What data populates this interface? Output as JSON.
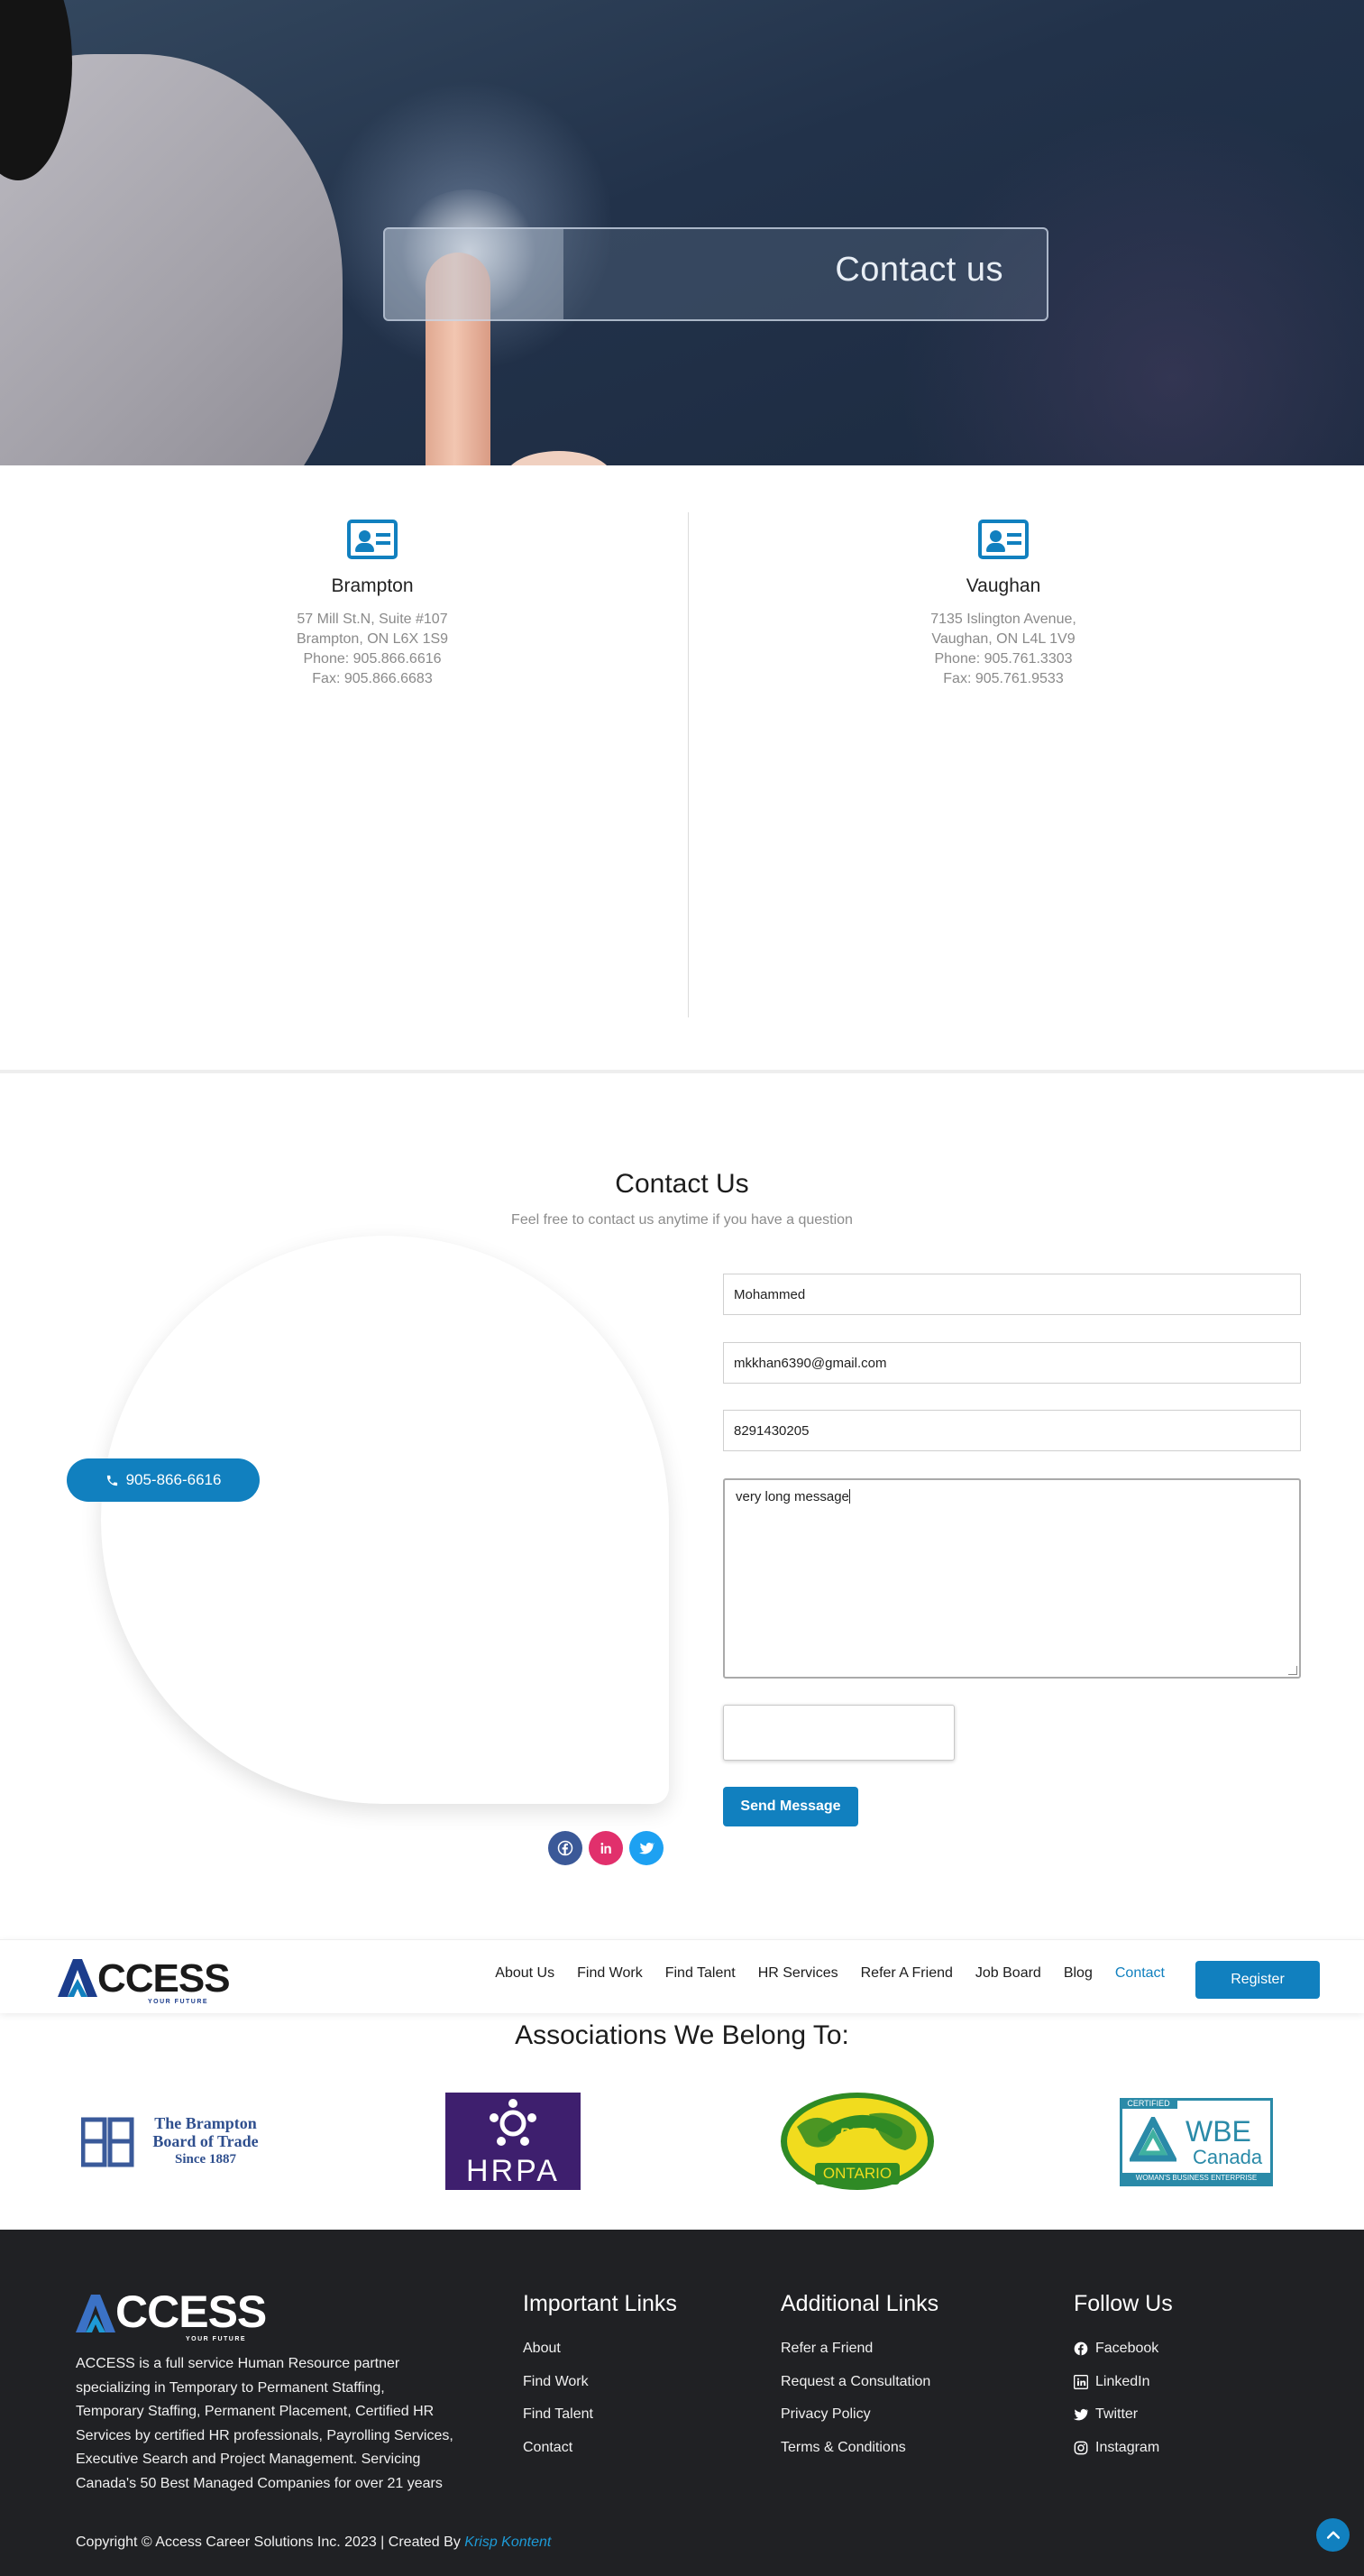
{
  "hero": {
    "title": "Contact us"
  },
  "offices": [
    {
      "name": "Brampton",
      "lines": [
        "57 Mill St.N, Suite #107",
        "Brampton, ON L6X 1S9",
        "Phone: 905.866.6616",
        "Fax: 905.866.6683"
      ]
    },
    {
      "name": "Vaughan",
      "lines": [
        "7135 Islington Avenue,",
        "Vaughan, ON L4L 1V9",
        "Phone: 905.761.3303",
        "Fax: 905.761.9533"
      ]
    }
  ],
  "contact": {
    "title": "Contact Us",
    "subtitle": "Feel free to contact us anytime if you have a question",
    "phone_button": "905-866-6616",
    "form": {
      "name": "Mohammed",
      "email": "mkkhan6390@gmail.com",
      "phone": "8291430205",
      "message": "very long message",
      "send_label": "Send Message"
    },
    "socials": [
      "facebook-icon",
      "linkedin-icon",
      "twitter-icon"
    ]
  },
  "nav": {
    "logo": {
      "word": "CCESS",
      "tagline": "YOUR FUTURE"
    },
    "links": [
      "About Us",
      "Find Work",
      "Find Talent",
      "HR Services",
      "Refer A Friend",
      "Job Board",
      "Blog",
      "Contact"
    ],
    "active": "Contact",
    "register_label": "Register"
  },
  "associations": {
    "title": "Associations We Belong To:",
    "logos": [
      {
        "name": "brampton-board-of-trade",
        "lines": [
          "The Brampton",
          "Board of Trade",
          "Since 1887"
        ]
      },
      {
        "name": "hrpa",
        "text": "HRPA"
      },
      {
        "name": "bpw-ontario",
        "top": "BPW",
        "bottom": "ONTARIO"
      },
      {
        "name": "wbe-canada",
        "certified": "CERTIFIED",
        "word": "WBE",
        "sub": "Canada",
        "bottom": "WOMAN'S BUSINESS ENTERPRISE"
      }
    ]
  },
  "footer": {
    "logo": {
      "word": "CCESS",
      "tagline": "YOUR FUTURE"
    },
    "description": "ACCESS is a full service Human Resource partner specializing in Temporary to Permanent Staffing, Temporary Staffing, Permanent Placement, Certified HR Services by certified HR professionals, Payrolling Services, Executive Search and Project Management. Servicing Canada's 50 Best Managed Companies for over 21 years",
    "important_links": {
      "title": "Important Links",
      "items": [
        "About",
        "Find Work",
        "Find Talent",
        "Contact"
      ]
    },
    "additional_links": {
      "title": "Additional Links",
      "items": [
        "Refer a Friend",
        "Request a Consultation",
        "Privacy Policy",
        "Terms & Conditions"
      ]
    },
    "follow": {
      "title": "Follow Us",
      "items": [
        {
          "label": "Facebook",
          "icon": "facebook-icon"
        },
        {
          "label": "LinkedIn",
          "icon": "linkedin-icon"
        },
        {
          "label": "Twitter",
          "icon": "twitter-icon"
        },
        {
          "label": "Instagram",
          "icon": "instagram-icon"
        }
      ]
    },
    "copyright": "Copyright © Access Career Solutions Inc. 2023 | Created By",
    "creator": "Krisp Kontent"
  },
  "colors": {
    "accent": "#1180bf",
    "footer_bg": "#202124",
    "hrpa": "#3e1f6e",
    "bpw_green": "#2f8a25",
    "bpw_yellow": "#f1dc1e",
    "wbe": "#2a8aa8"
  }
}
